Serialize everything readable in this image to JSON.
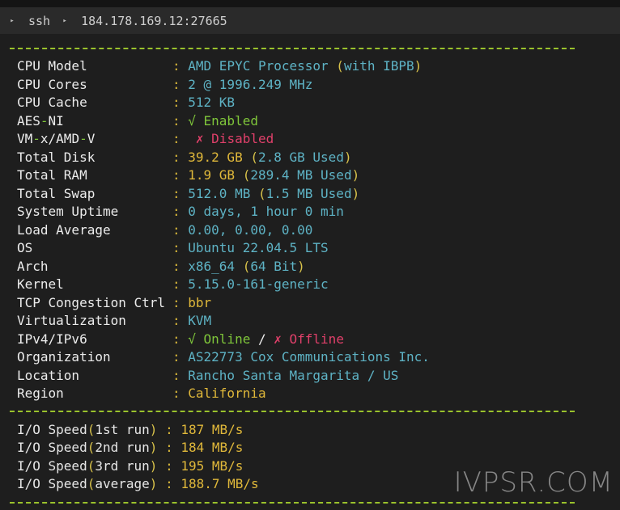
{
  "tabbar": {
    "tab1_label": "ssh",
    "tab2_label": "184.178.169.12:27665",
    "arrow_glyph": "▸"
  },
  "info": {
    "cpu_model_label": "CPU Model",
    "cpu_model_value": "AMD EPYC Processor",
    "cpu_model_extra": "with IBPB",
    "cpu_cores_label": "CPU Cores",
    "cpu_cores_value": "2 @ 1996.249 MHz",
    "cpu_cache_label": "CPU Cache",
    "cpu_cache_value": "512 KB",
    "aes_label_a": "AES",
    "aes_label_b": "NI",
    "aes_value": "√ Enabled",
    "vmx_label_a": "VM",
    "vmx_label_b": "x/AMD",
    "vmx_label_c": "V",
    "vmx_value": "✗ Disabled",
    "disk_label": "Total Disk",
    "disk_value": "39.2 GB",
    "disk_used": "2.8 GB Used",
    "ram_label": "Total RAM",
    "ram_value": "1.9 GB",
    "ram_used": "289.4 MB Used",
    "swap_label": "Total Swap",
    "swap_value": "512.0 MB",
    "swap_used": "1.5 MB Used",
    "uptime_label": "System Uptime",
    "uptime_value": "0 days, 1 hour 0 min",
    "load_label": "Load Average",
    "load_value": "0.00, 0.00, 0.00",
    "os_label": "OS",
    "os_value": "Ubuntu 22.04.5 LTS",
    "arch_label": "Arch",
    "arch_value": "x86_64",
    "arch_bits": "64 Bit",
    "kernel_label": "Kernel",
    "kernel_value": "5.15.0-161-generic",
    "tcp_label": "TCP Congestion Ctrl",
    "tcp_value": "bbr",
    "virt_label": "Virtualization",
    "virt_value": "KVM",
    "ip_label": "IPv4/IPv6",
    "ipv4_value": "√ Online",
    "ip_sep": "/",
    "ipv6_value": "✗ Offline",
    "org_label": "Organization",
    "org_value": "AS22773 Cox Communications Inc.",
    "loc_label": "Location",
    "loc_value": "Rancho Santa Margarita / US",
    "region_label": "Region",
    "region_value": "California"
  },
  "io": {
    "prefix": "I/O Speed",
    "run1_label": "1st run",
    "run1_value": "187 MB/s",
    "run2_label": "2nd run",
    "run2_value": "184 MB/s",
    "run3_label": "3rd run",
    "run3_value": "195 MB/s",
    "avg_label": "average",
    "avg_value": "188.7 MB/s"
  },
  "watermark": "IVPSR.COM",
  "colors": {
    "background": "#1e1e1e",
    "divider": "#9ac22c",
    "cyan": "#5eb3c5",
    "green": "#7fc63a",
    "red": "#e0406a",
    "yellow": "#e0b83a"
  }
}
